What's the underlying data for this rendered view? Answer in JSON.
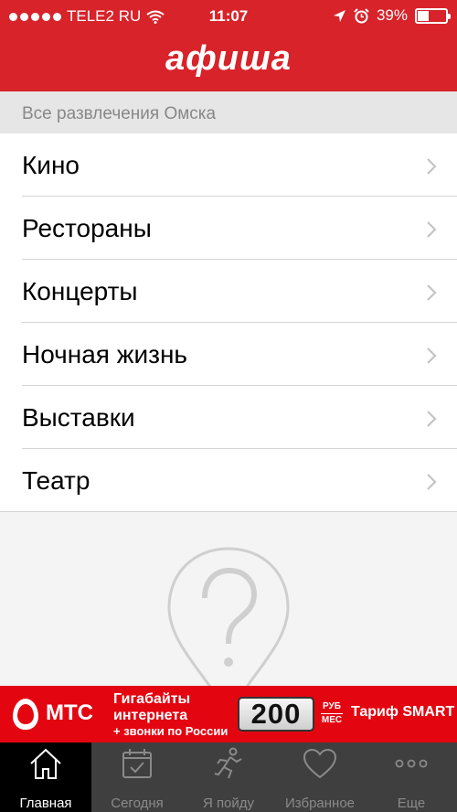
{
  "status_bar": {
    "carrier": "TELE2 RU",
    "time": "11:07",
    "battery": "39%",
    "battery_level": 0.39,
    "icons": [
      "signal-dots",
      "wifi-icon",
      "location-arrow-icon",
      "alarm-icon",
      "battery-icon"
    ]
  },
  "header": {
    "logo": "афиша"
  },
  "section": {
    "title": "Все развлечения Омска"
  },
  "menu": {
    "items": [
      {
        "label": "Кино"
      },
      {
        "label": "Рестораны"
      },
      {
        "label": "Концерты"
      },
      {
        "label": "Ночная жизнь"
      },
      {
        "label": "Выставки"
      },
      {
        "label": "Театр"
      }
    ]
  },
  "ad": {
    "brand": "МТС",
    "line1": "Гигабайты",
    "line2": "интернета",
    "line3": "+ звонки по России",
    "price": "200",
    "unit_top": "РУБ",
    "unit_bottom": "МЕС",
    "tariff": "Тариф SMART",
    "colors": {
      "background": "#e30611"
    }
  },
  "tabbar": {
    "tabs": [
      {
        "label": "Главная",
        "icon": "home-icon",
        "active": true
      },
      {
        "label": "Сегодня",
        "icon": "calendar-icon"
      },
      {
        "label": "Я пойду",
        "icon": "runner-icon"
      },
      {
        "label": "Избранное",
        "icon": "heart-icon"
      },
      {
        "label": "Еще",
        "icon": "more-icon"
      }
    ]
  },
  "colors": {
    "accent": "#d8232a",
    "tabbar": "#3f3f3f",
    "tab_active": "#000000"
  }
}
